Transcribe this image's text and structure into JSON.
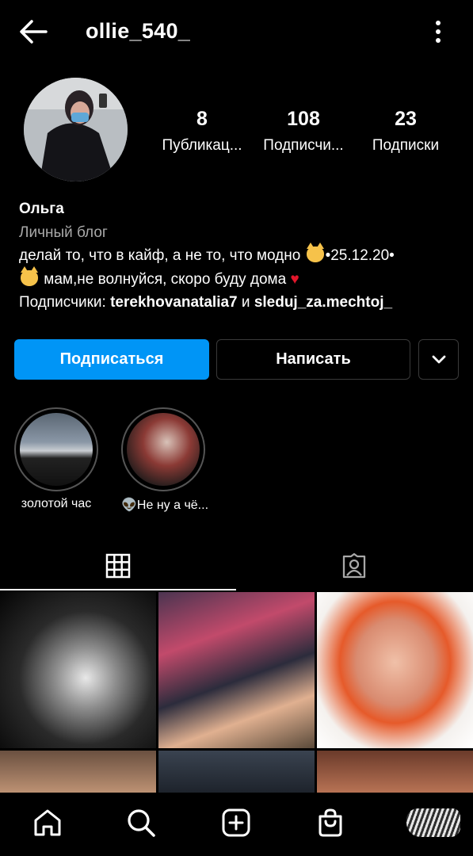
{
  "header": {
    "username": "ollie_540_"
  },
  "stats": [
    {
      "value": "8",
      "label": "Публикац..."
    },
    {
      "value": "108",
      "label": "Подписчи..."
    },
    {
      "value": "23",
      "label": "Подписки"
    }
  ],
  "bio": {
    "name": "Ольга",
    "category": "Личный блог",
    "line1_text": "делай то, что в кайф, а не то, что модно",
    "line1_date": "•25.12.20•",
    "line2_text": "мам,не волнуйся, скоро буду дома",
    "followers_prefix": "Подписчики:",
    "follower1": "terekhovanatalia7",
    "conj": "и",
    "follower2": "sleduj_za.mechtoj_"
  },
  "actions": {
    "follow_label": "Подписаться",
    "message_label": "Написать"
  },
  "highlights": [
    {
      "label": "золотой час"
    },
    {
      "label": "👽Не ну а чё..."
    }
  ],
  "tabs": {
    "grid_icon": "grid-icon",
    "tagged_icon": "tagged-icon"
  },
  "nav": {
    "items": [
      "home-icon",
      "search-icon",
      "add-icon",
      "shop-icon",
      "profile-avatar"
    ]
  },
  "colors": {
    "accent": "#0095f6",
    "background": "#000000",
    "secondary_text": "#a8a8a8",
    "heart": "#e3162b"
  }
}
